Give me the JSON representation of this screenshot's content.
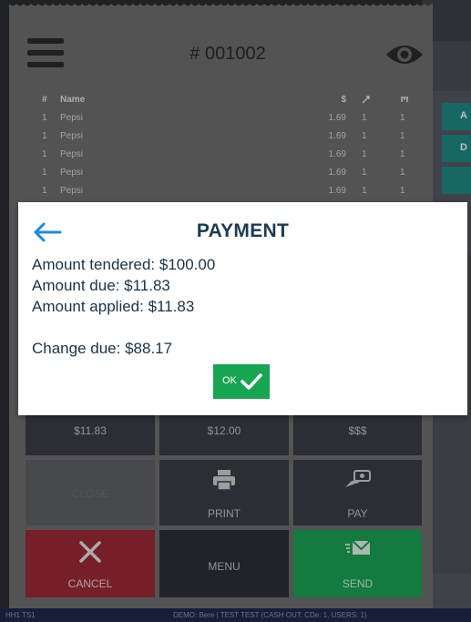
{
  "order": {
    "title": "# 001002"
  },
  "items": {
    "headers": {
      "num": "#",
      "name": "Name",
      "price": "$"
    },
    "rows": [
      {
        "num": "1",
        "name": "Pepsi",
        "price": "1.69",
        "q1": "1",
        "q2": "1"
      },
      {
        "num": "1",
        "name": "Pepsi",
        "price": "1.69",
        "q1": "1",
        "q2": "1"
      },
      {
        "num": "1",
        "name": "Pepsi",
        "price": "1.69",
        "q1": "1",
        "q2": "1"
      },
      {
        "num": "1",
        "name": "Pepsi",
        "price": "1.69",
        "q1": "1",
        "q2": "1"
      },
      {
        "num": "1",
        "name": "Pepsi",
        "price": "1.69",
        "q1": "1",
        "q2": "1"
      }
    ]
  },
  "quick_amounts": [
    "$11.83",
    "$12.00",
    "$$$"
  ],
  "buttons": {
    "close": "CLOSE",
    "print": "PRINT",
    "pay": "PAY",
    "cancel": "CANCEL",
    "menu": "MENU",
    "send": "SEND"
  },
  "side_buttons": [
    "A",
    "D"
  ],
  "status": {
    "left": "HH1  TS1",
    "center": "DEMO: Bere | TEST TEST (CASH OUT: CDe: 1, USERS: 1)"
  },
  "payment": {
    "title": "PAYMENT",
    "amount_tendered": "Amount tendered: $100.00",
    "amount_due": "Amount due: $11.83",
    "amount_applied": "Amount applied: $11.83",
    "change_due": "Change due: $88.17",
    "ok_label": "OK"
  },
  "colors": {
    "accent_blue": "#1e88e5",
    "success_green": "#18a552",
    "cancel_red": "#9c2a36"
  }
}
